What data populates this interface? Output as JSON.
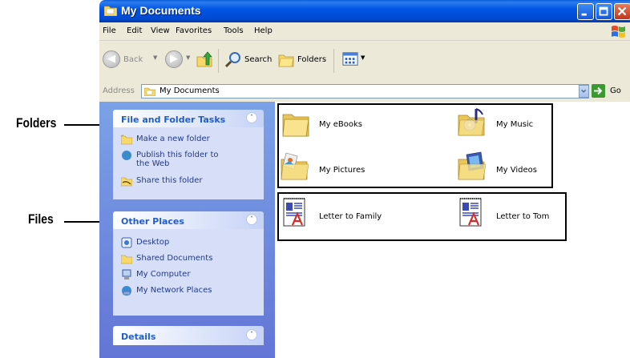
{
  "callouts": {
    "folders": "Folders",
    "files": "Files"
  },
  "window": {
    "title": "My Documents"
  },
  "menu": [
    "File",
    "Edit",
    "View",
    "Favorites",
    "Tools",
    "Help"
  ],
  "toolbar": {
    "back": "Back",
    "search": "Search",
    "folders": "Folders"
  },
  "address": {
    "label": "Address",
    "value": "My Documents",
    "go": "Go"
  },
  "taskpane": {
    "file_folder_tasks": {
      "title": "File and Folder Tasks",
      "items": [
        "Make a new folder",
        "Publish this folder to the Web",
        "Share this folder"
      ]
    },
    "other_places": {
      "title": "Other Places",
      "items": [
        "Desktop",
        "Shared Documents",
        "My Computer",
        "My Network Places"
      ]
    },
    "details": {
      "title": "Details"
    }
  },
  "folders": [
    "My eBooks",
    "My Music",
    "My Pictures",
    "My Videos"
  ],
  "files": [
    "Letter to Family",
    "Letter to Tom"
  ]
}
